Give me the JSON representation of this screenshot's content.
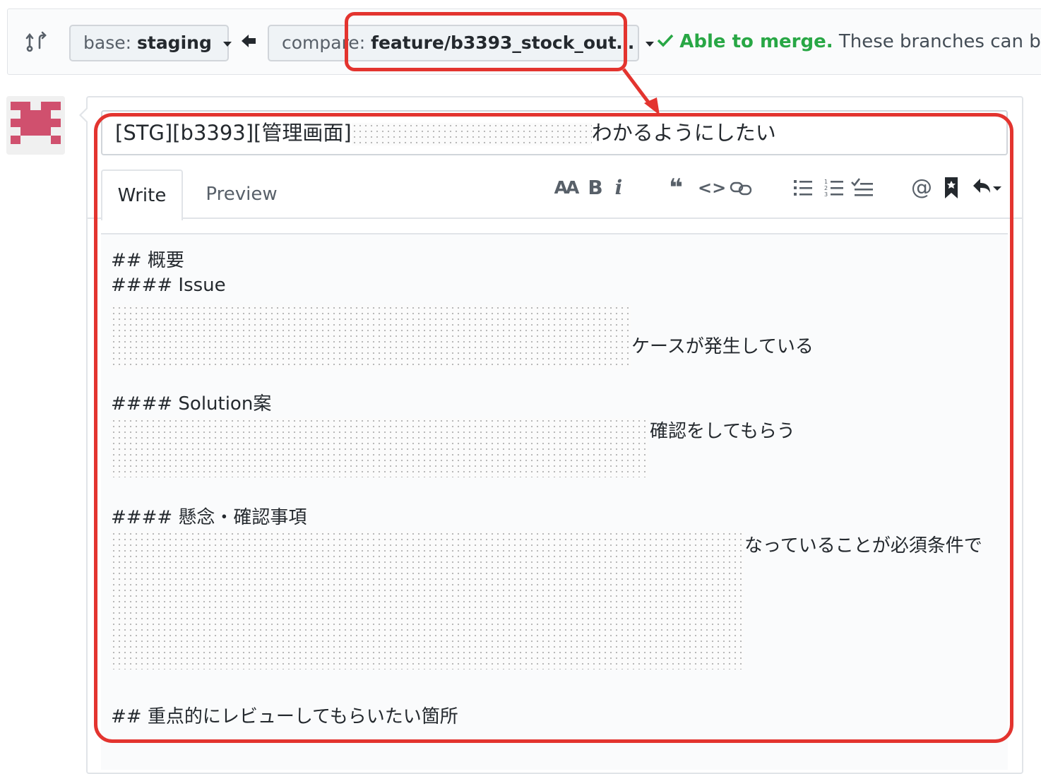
{
  "branch_bar": {
    "base_key": "base:",
    "base_value": "staging",
    "compare_key": "compare:",
    "compare_value": "feature/b3393_stock_out…",
    "status_ok": "Able to merge.",
    "status_rest": "These branches can be a"
  },
  "pr": {
    "title_prefix": "[STG][b3393][管理画面]",
    "title_suffix": "わかるようにしたい"
  },
  "tabs": {
    "write": "Write",
    "preview": "Preview"
  },
  "toolbar": {
    "heading": "AA",
    "bold": "B",
    "italic": "i",
    "quote": "❝",
    "code": "<>",
    "link": "⊂⊃",
    "bullet": "☰",
    "numbered": "☰",
    "task": "☰",
    "mention": "@",
    "saved": "■",
    "reply": "↶"
  },
  "body": {
    "h_overview": "## 概要",
    "h_issue": "#### Issue",
    "issue_tail": "ケースが発生している",
    "h_solution": "#### Solution案",
    "solution_tail": "確認をしてもらう",
    "h_concern": "#### 懸念・確認事項",
    "concern_tail": "なっていることが必須条件で",
    "h_review": "## 重点的にレビューしてもらいたい箇所"
  },
  "colors": {
    "highlight": "#e3342f",
    "success": "#28a745"
  }
}
